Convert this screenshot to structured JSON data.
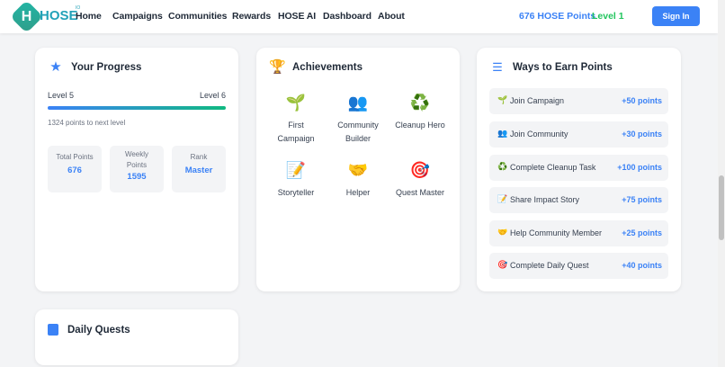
{
  "header": {
    "logo_letter": "H",
    "logo_text": "HOSE",
    "logo_sup": "IO",
    "nav": [
      "Home",
      "Campaigns",
      "Communities",
      "Rewards",
      "HOSE AI",
      "Dashboard",
      "About"
    ],
    "points": "676 HOSE Points",
    "level": "Level 1",
    "sign_in": "Sign In"
  },
  "progress": {
    "title": "Your Progress",
    "icon": "star-icon",
    "level_from": "Level 5",
    "level_to": "Level 6",
    "progress_percent": 100,
    "to_next": "1324 points to next level",
    "stats": [
      {
        "label": "Total Points",
        "value": "676"
      },
      {
        "label": "Weekly Points",
        "value": "1595"
      },
      {
        "label": "Rank",
        "value": "Master"
      }
    ]
  },
  "achievements": {
    "title": "Achievements",
    "icon": "trophy-icon",
    "items": [
      {
        "icon": "🌱",
        "label": "First Campaign"
      },
      {
        "icon": "👥",
        "label": "Community Builder"
      },
      {
        "icon": "♻️",
        "label": "Cleanup Hero"
      },
      {
        "icon": "📝",
        "label": "Storyteller"
      },
      {
        "icon": "🤝",
        "label": "Helper"
      },
      {
        "icon": "🎯",
        "label": "Quest Master"
      }
    ]
  },
  "ways": {
    "title": "Ways to Earn Points",
    "icon": "list-check-icon",
    "items": [
      {
        "icon": "🌱",
        "label": "Join Campaign",
        "points": "+50 points"
      },
      {
        "icon": "👥",
        "label": "Join Community",
        "points": "+30 points"
      },
      {
        "icon": "♻️",
        "label": "Complete Cleanup Task",
        "points": "+100 points"
      },
      {
        "icon": "📝",
        "label": "Share Impact Story",
        "points": "+75 points"
      },
      {
        "icon": "🤝",
        "label": "Help Community Member",
        "points": "+25 points"
      },
      {
        "icon": "🎯",
        "label": "Complete Daily Quest",
        "points": "+40 points"
      }
    ]
  },
  "daily": {
    "title": "Daily Quests",
    "icon": "calendar-icon"
  },
  "colors": {
    "accent": "#3b82f6",
    "green": "#22c55e"
  }
}
